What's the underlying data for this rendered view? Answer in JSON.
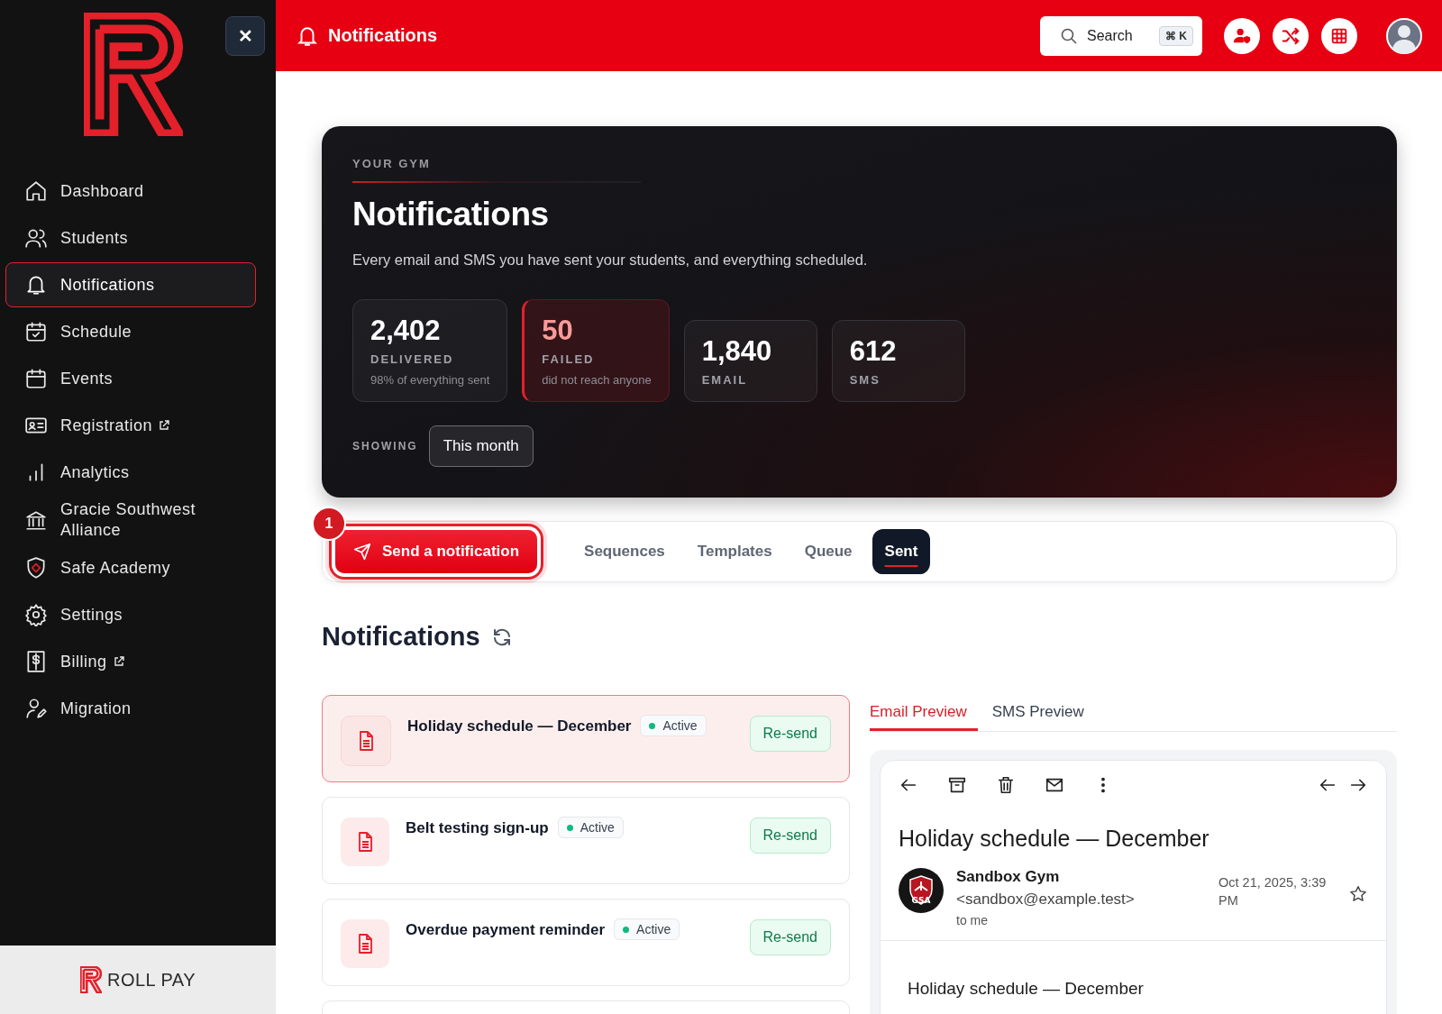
{
  "sidebar": {
    "close_label": "✕",
    "items": [
      {
        "label": "Dashboard",
        "external": false,
        "selected": false
      },
      {
        "label": "Students",
        "external": false,
        "selected": false
      },
      {
        "label": "Notifications",
        "external": false,
        "selected": true
      },
      {
        "label": "Schedule",
        "external": false,
        "selected": false
      },
      {
        "label": "Events",
        "external": false,
        "selected": false
      },
      {
        "label": "Registration",
        "external": true,
        "selected": false
      },
      {
        "label": "Analytics",
        "external": false,
        "selected": false
      },
      {
        "label": "Gracie Southwest Alliance",
        "external": false,
        "selected": false
      },
      {
        "label": "Safe Academy",
        "external": false,
        "selected": false
      },
      {
        "label": "Settings",
        "external": false,
        "selected": false
      },
      {
        "label": "Billing",
        "external": true,
        "selected": false
      },
      {
        "label": "Migration",
        "external": false,
        "selected": false
      }
    ],
    "footer_brand": "ROLL PAY"
  },
  "topbar": {
    "title": "Notifications",
    "search": {
      "placeholder": "Search",
      "shortcut": "⌘ K"
    }
  },
  "hero": {
    "eyebrow": "YOUR GYM",
    "title": "Notifications",
    "subtitle": "Every email and SMS you have sent your students, and everything scheduled.",
    "stats": [
      {
        "value": "2,402",
        "label": "DELIVERED",
        "note": "98% of everything sent",
        "kind": "normal"
      },
      {
        "value": "50",
        "label": "FAILED",
        "note": "did not reach anyone",
        "kind": "alert"
      },
      {
        "value": "1,840",
        "label": "EMAIL",
        "kind": "normal"
      },
      {
        "value": "612",
        "label": "SMS",
        "kind": "normal"
      }
    ],
    "period_label": "SHOWING",
    "period": "This month"
  },
  "actions": {
    "send_button": "Send a notification",
    "badge": "1",
    "tabs": [
      {
        "label": "Sequences",
        "selected": false
      },
      {
        "label": "Templates",
        "selected": false
      },
      {
        "label": "Queue",
        "selected": false
      },
      {
        "label": "Sent",
        "selected": true
      }
    ]
  },
  "section_title": "Notifications",
  "notifications": [
    {
      "title": "Holiday schedule — December",
      "status": "Active",
      "action": "Re-send",
      "selected": true
    },
    {
      "title": "Belt testing sign-up",
      "status": "Active",
      "action": "Re-send",
      "selected": false
    },
    {
      "title": "Overdue payment reminder",
      "status": "Active",
      "action": "Re-send",
      "selected": false
    }
  ],
  "preview": {
    "tabs": [
      {
        "label": "Email Preview",
        "selected": true
      },
      {
        "label": "SMS Preview",
        "selected": false
      }
    ],
    "subject": "Holiday schedule — December",
    "sender_name": "Sandbox Gym",
    "sender_email": "<sandbox@example.test>",
    "recipient": "to me",
    "avatar_text": "GSA",
    "date": "Oct 21, 2025, 3:39 PM",
    "body_heading": "Holiday schedule — December"
  }
}
